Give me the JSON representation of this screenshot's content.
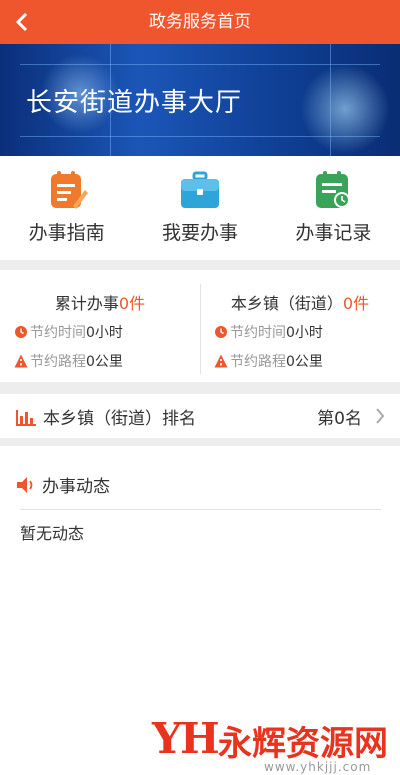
{
  "header": {
    "title": "政务服务首页",
    "back_icon": "chevron-left-icon"
  },
  "banner": {
    "text": "长安街道办事大厅"
  },
  "services": [
    {
      "label": "办事指南",
      "icon": "guide-icon",
      "color": "#f07a2c"
    },
    {
      "label": "我要办事",
      "icon": "briefcase-icon",
      "color": "#2ea5d8"
    },
    {
      "label": "办事记录",
      "icon": "record-icon",
      "color": "#3aa35a"
    }
  ],
  "stats": {
    "left": {
      "title": "累计办事",
      "count": "0件",
      "time_label": "节约时间",
      "time_value": "0小时",
      "road_label": "节约路程",
      "road_value": "0公里"
    },
    "right": {
      "title": "本乡镇（街道）",
      "count": "0件",
      "time_label": "节约时间",
      "time_value": "0小时",
      "road_label": "节约路程",
      "road_value": "0公里"
    }
  },
  "rank": {
    "label": "本乡镇（街道）排名",
    "value": "第0名"
  },
  "news": {
    "title": "办事动态",
    "empty": "暂无动态"
  },
  "watermark": {
    "name": "永辉资源网",
    "url": "www.yhkjjj.com"
  },
  "colors": {
    "accent": "#f0562e"
  }
}
